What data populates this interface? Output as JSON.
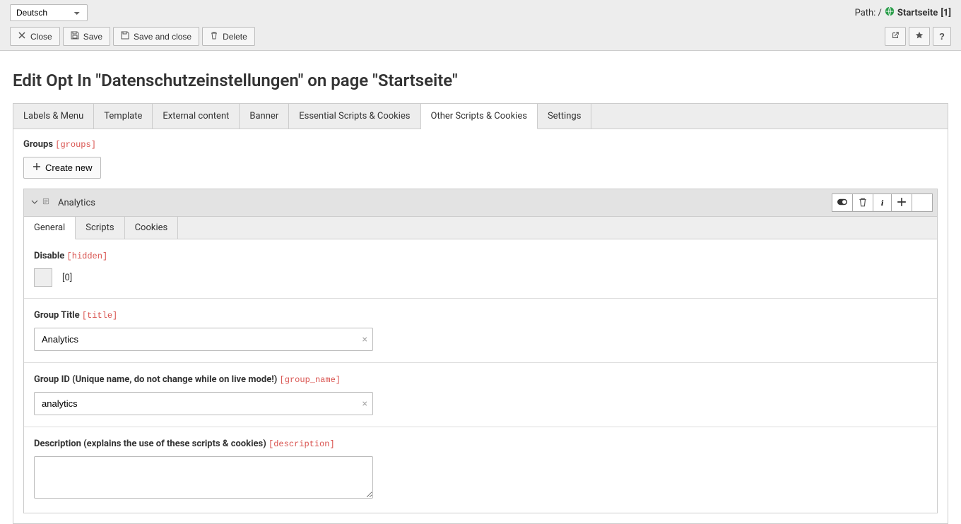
{
  "header": {
    "language": "Deutsch",
    "path_label": "Path: /",
    "page_name": "Startseite",
    "page_id": "[1]",
    "buttons": {
      "close": "Close",
      "save": "Save",
      "save_close": "Save and close",
      "delete": "Delete"
    }
  },
  "page_title": "Edit Opt In \"Datenschutzeinstellungen\" on page \"Startseite\"",
  "tabs": [
    {
      "label": "Labels & Menu"
    },
    {
      "label": "Template"
    },
    {
      "label": "External content"
    },
    {
      "label": "Banner"
    },
    {
      "label": "Essential Scripts & Cookies"
    },
    {
      "label": "Other Scripts & Cookies"
    },
    {
      "label": "Settings"
    }
  ],
  "active_tab": 5,
  "groups_section": {
    "label": "Groups",
    "tech": "[groups]",
    "create_new": "Create new"
  },
  "record": {
    "title": "Analytics",
    "sub_tabs": [
      {
        "label": "General"
      },
      {
        "label": "Scripts"
      },
      {
        "label": "Cookies"
      }
    ],
    "active_sub_tab": 0,
    "fields": {
      "disable": {
        "label": "Disable",
        "tech": "[hidden]",
        "value_display": "[0]"
      },
      "title": {
        "label": "Group Title",
        "tech": "[title]",
        "value": "Analytics"
      },
      "group_id": {
        "label": "Group ID (Unique name, do not change while on live mode!)",
        "tech": "[group_name]",
        "value": "analytics"
      },
      "description": {
        "label": "Description (explains the use of these scripts & cookies)",
        "tech": "[description]",
        "value": ""
      }
    }
  }
}
